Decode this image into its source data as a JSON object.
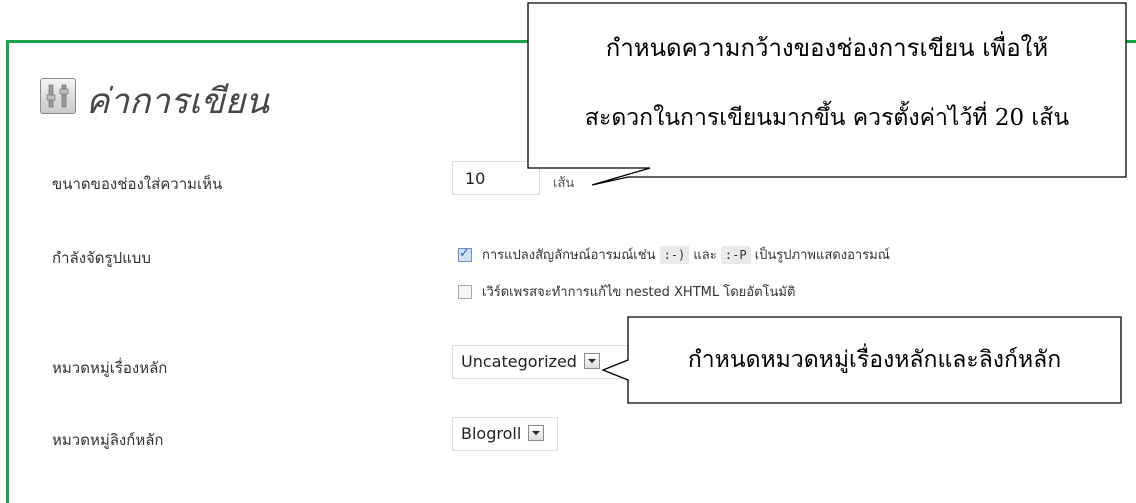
{
  "page": {
    "title": "ค่าการเขียน"
  },
  "settings": {
    "comment_box_label": "ขนาดของช่องใส่ความเห็น",
    "comment_box_value": "10",
    "comment_box_unit": "เส้น",
    "formatting_label": "กำลังจัดรูปแบบ",
    "formatting_option1": {
      "checked": true,
      "text_before": "การแปลงสัญลักษณ์อารมณ์เช่น",
      "code1": ":-)",
      "text_mid": "และ",
      "code2": ":-P",
      "text_after": "เป็นรูปภาพแสดงอารมณ์"
    },
    "formatting_option2": {
      "checked": false,
      "text": "เวิร์ดเพรสจะทำการแก้ไข nested XHTML โดยอัตโนมัติ"
    },
    "default_category_label": "หมวดหมู่เรื่องหลัก",
    "default_category_value": "Uncategorized",
    "default_link_category_label": "หมวดหมู่ลิงก์หลัก",
    "default_link_category_value": "Blogroll"
  },
  "callouts": {
    "top_line1": "กำหนดความกว้างของช่องการเขียน เพื่อให้",
    "top_line2": "สะดวกในการเขียนมากขึ้น ควรตั้งค่าไว้ที่ 20 เส้น",
    "bottom": "กำหนดหมวดหมู่เรื่องหลักและลิงก์หลัก"
  },
  "icons": {
    "page_icon": "settings-tools-icon",
    "checkbox_checked": "check-icon",
    "select_arrow": "chevron-down-icon"
  },
  "colors": {
    "panel_border": "#1aa24a"
  }
}
